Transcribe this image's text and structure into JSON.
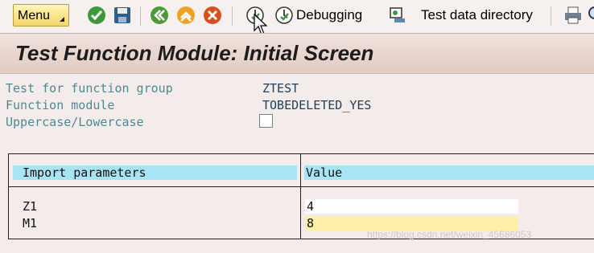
{
  "toolbar": {
    "menu_label": "Menu",
    "debugging_label": "Debugging",
    "test_data_directory_label": "Test data directory"
  },
  "page_title": "Test Function Module: Initial Screen",
  "fields": {
    "function_group_label": "Test for function group",
    "function_group_value": "ZTEST",
    "function_module_label": "Function module",
    "function_module_value": "TOBEDELETED_YES",
    "uppercase_label": "Uppercase/Lowercase"
  },
  "import_table": {
    "header_params": "Import parameters",
    "header_value": "Value",
    "rows": [
      {
        "name": "Z1",
        "value": "4"
      },
      {
        "name": "M1",
        "value": "8"
      }
    ]
  },
  "colors": {
    "header_cyan": "#a9e4f4",
    "field_yellow": "#fff0a8",
    "label_teal": "#4e8a92"
  },
  "watermark": "https://blog.csdn.net/weixin_45686053"
}
